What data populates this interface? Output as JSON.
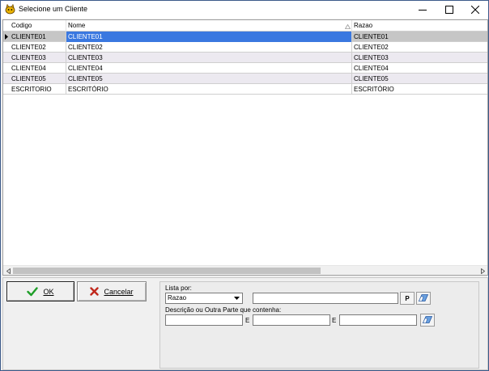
{
  "window": {
    "title": "Selecione um Cliente"
  },
  "grid": {
    "columns": [
      "Codigo",
      "Nome",
      "Razao"
    ],
    "rows": [
      {
        "codigo": "CLIENTE01",
        "nome": "CLIENTE01",
        "razao": "CLIENTE01"
      },
      {
        "codigo": "CLIENTE02",
        "nome": "CLIENTE02",
        "razao": "CLIENTE02"
      },
      {
        "codigo": "CLIENTE03",
        "nome": "CLIENTE03",
        "razao": "CLIENTE03"
      },
      {
        "codigo": "CLIENTE04",
        "nome": "CLIENTE04",
        "razao": "CLIENTE04"
      },
      {
        "codigo": "CLIENTE05",
        "nome": "CLIENTE05",
        "razao": "CLIENTE05"
      },
      {
        "codigo": "ESCRITORIO",
        "nome": "ESCRITÓRIO",
        "razao": "ESCRITÓRIO"
      }
    ],
    "selected_row": 0,
    "sorted_column": "Nome"
  },
  "buttons": {
    "ok_label": "OK",
    "cancel_label": "Cancelar"
  },
  "filter": {
    "list_by_label": "Lista por:",
    "list_by_value": "Razao",
    "search_value": "",
    "search_button_label": "P",
    "description_label": "Descrição ou Outra Parte que contenha:",
    "desc1_value": "",
    "desc2_value": "",
    "desc3_value": "",
    "and_label_1": "E",
    "and_label_2": "E"
  },
  "colors": {
    "selection": "#3a78e0",
    "ok_check": "#1e9e28",
    "cancel_x": "#c0281c"
  },
  "icons": [
    "app-cat-icon",
    "minimize-icon",
    "maximize-icon",
    "close-icon",
    "sort-indicator-icon",
    "row-indicator-icon",
    "scroll-left-icon",
    "scroll-right-icon",
    "check-icon",
    "x-icon",
    "chevron-down-icon",
    "eraser-icon"
  ]
}
